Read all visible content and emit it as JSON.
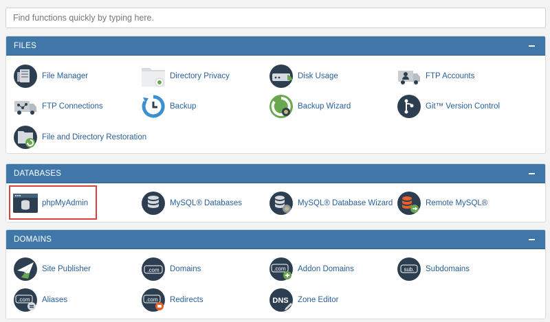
{
  "search": {
    "placeholder": "Find functions quickly by typing here."
  },
  "sections": [
    {
      "title": "FILES",
      "items": [
        {
          "label": "File Manager",
          "icon": "file-manager-icon"
        },
        {
          "label": "Directory Privacy",
          "icon": "directory-privacy-icon"
        },
        {
          "label": "Disk Usage",
          "icon": "disk-usage-icon"
        },
        {
          "label": "FTP Accounts",
          "icon": "ftp-accounts-icon"
        },
        {
          "label": "FTP Connections",
          "icon": "ftp-connections-icon"
        },
        {
          "label": "Backup",
          "icon": "backup-icon"
        },
        {
          "label": "Backup Wizard",
          "icon": "backup-wizard-icon"
        },
        {
          "label": "Git™ Version Control",
          "icon": "git-icon"
        },
        {
          "label": "File and Directory Restoration",
          "icon": "restoration-icon"
        }
      ]
    },
    {
      "title": "DATABASES",
      "items": [
        {
          "label": "phpMyAdmin",
          "icon": "phpmyadmin-icon"
        },
        {
          "label": "MySQL® Databases",
          "icon": "mysql-databases-icon"
        },
        {
          "label": "MySQL® Database Wizard",
          "icon": "mysql-wizard-icon"
        },
        {
          "label": "Remote MySQL®",
          "icon": "remote-mysql-icon"
        }
      ]
    },
    {
      "title": "DOMAINS",
      "items": [
        {
          "label": "Site Publisher",
          "icon": "site-publisher-icon"
        },
        {
          "label": "Domains",
          "icon": "domains-icon"
        },
        {
          "label": "Addon Domains",
          "icon": "addon-domains-icon"
        },
        {
          "label": "Subdomains",
          "icon": "subdomains-icon"
        },
        {
          "label": "Aliases",
          "icon": "aliases-icon"
        },
        {
          "label": "Redirects",
          "icon": "redirects-icon"
        },
        {
          "label": "Zone Editor",
          "icon": "zone-editor-icon"
        }
      ]
    }
  ],
  "icon_text": {
    "com": ".com",
    "sub": "sub.",
    "dns": "DNS"
  },
  "colors": {
    "header": "#3f78a8",
    "link": "#29609a",
    "icon_dark": "#2d3e50",
    "green": "#6aa84f",
    "orange": "#e8612c",
    "highlight": "#d9413b"
  }
}
